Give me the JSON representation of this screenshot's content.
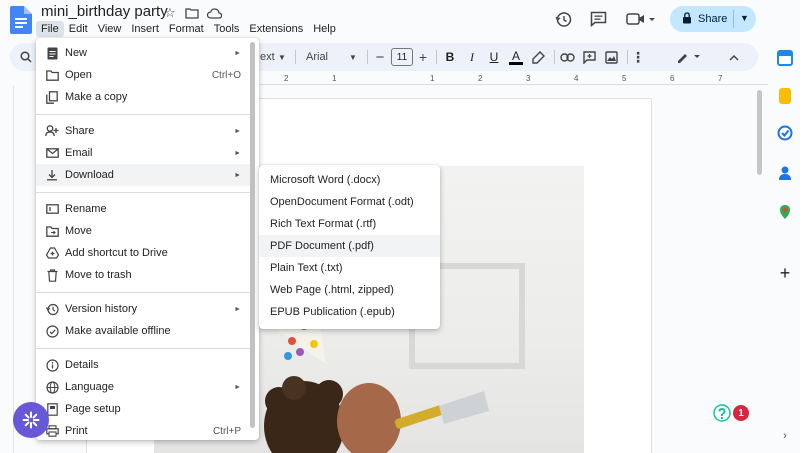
{
  "document": {
    "title": "mini_birthday party"
  },
  "menubar": [
    "File",
    "Edit",
    "View",
    "Insert",
    "Format",
    "Tools",
    "Extensions",
    "Help"
  ],
  "share": {
    "label": "Share"
  },
  "toolbar": {
    "style_partial": "ext",
    "font": "Arial",
    "font_size": "11"
  },
  "ruler": [
    "2",
    "1",
    "1",
    "2",
    "3",
    "4",
    "5",
    "6",
    "7"
  ],
  "file_menu": {
    "items": [
      {
        "label": "New",
        "icon": "new-doc-icon",
        "submenu": true
      },
      {
        "label": "Open",
        "icon": "folder-icon",
        "shortcut": "Ctrl+O"
      },
      {
        "label": "Make a copy",
        "icon": "copy-icon"
      },
      {
        "label": "Share",
        "icon": "share-person-icon",
        "submenu": true
      },
      {
        "label": "Email",
        "icon": "email-icon",
        "submenu": true
      },
      {
        "label": "Download",
        "icon": "download-icon",
        "submenu": true,
        "highlighted": true
      },
      {
        "label": "Rename",
        "icon": "rename-icon"
      },
      {
        "label": "Move",
        "icon": "move-icon"
      },
      {
        "label": "Add shortcut to Drive",
        "icon": "drive-shortcut-icon"
      },
      {
        "label": "Move to trash",
        "icon": "trash-icon"
      },
      {
        "label": "Version history",
        "icon": "history-icon",
        "submenu": true
      },
      {
        "label": "Make available offline",
        "icon": "offline-icon"
      },
      {
        "label": "Details",
        "icon": "info-icon"
      },
      {
        "label": "Language",
        "icon": "globe-icon",
        "submenu": true
      },
      {
        "label": "Page setup",
        "icon": "page-setup-icon"
      },
      {
        "label": "Print",
        "icon": "print-icon",
        "shortcut": "Ctrl+P"
      }
    ]
  },
  "download_menu": {
    "items": [
      "Microsoft Word (.docx)",
      "OpenDocument Format (.odt)",
      "Rich Text Format (.rtf)",
      "PDF Document (.pdf)",
      "Plain Text (.txt)",
      "Web Page (.html, zipped)",
      "EPUB Publication (.epub)"
    ],
    "highlighted_index": 3
  },
  "notification": {
    "count": "1"
  },
  "colors": {
    "share_bg": "#c2e7ff",
    "toolbar_bg": "#edf2fa",
    "fab": "#6658d6",
    "badge": "#d7263d",
    "docs_blue": "#4285f4"
  }
}
